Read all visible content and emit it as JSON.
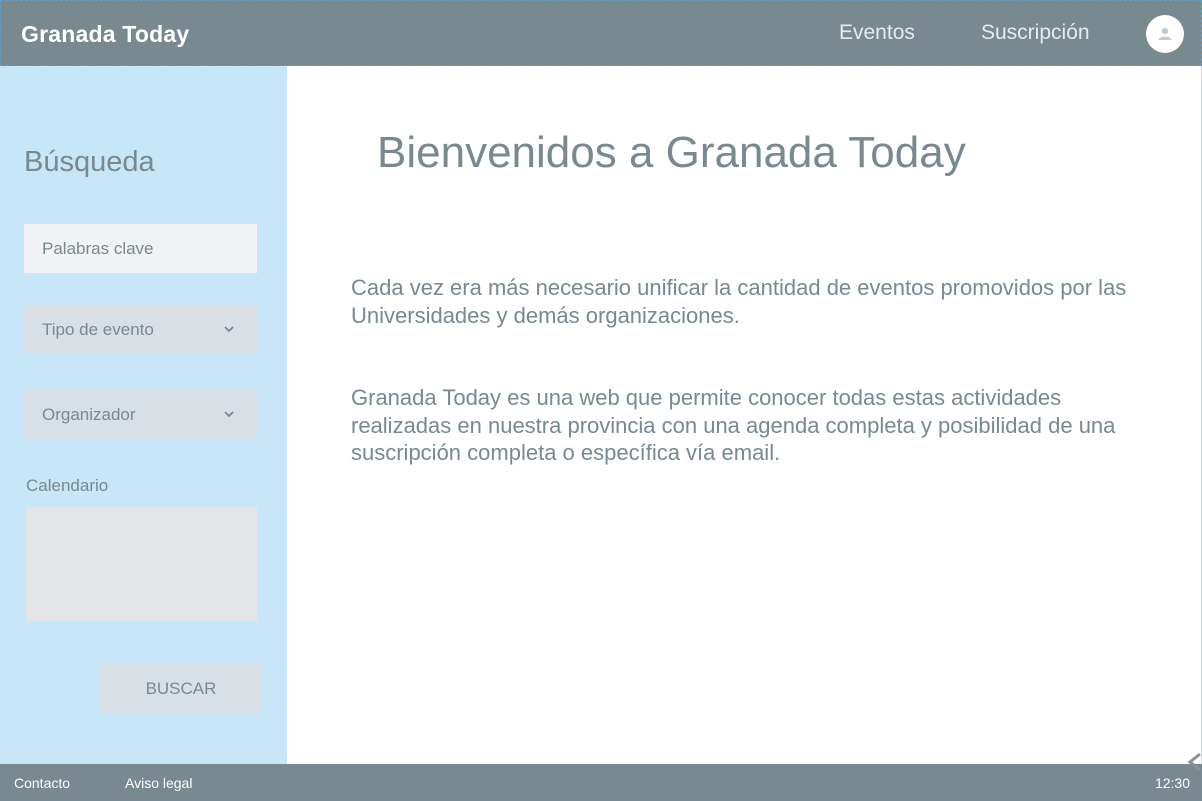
{
  "header": {
    "brand": "Granada Today",
    "nav": {
      "eventos": "Eventos",
      "suscripcion": "Suscripción"
    },
    "avatar_icon": "user-icon"
  },
  "sidebar": {
    "title": "Búsqueda",
    "keywords_placeholder": "Palabras clave",
    "event_type_label": "Tipo de evento",
    "organizer_label": "Organizador",
    "calendar_label": "Calendario",
    "search_button": "BUSCAR"
  },
  "main": {
    "title": "Bienvenidos a Granada Today",
    "paragraph1": "Cada vez era más necesario unificar la cantidad de eventos promovidos por las Universidades y demás organizaciones.",
    "paragraph2": "Granada Today es una web que permite conocer todas estas actividades realizadas en nuestra provincia con una agenda completa y posibilidad de una suscripción completa o específica vía email."
  },
  "footer": {
    "contacto": "Contacto",
    "aviso_legal": "Aviso legal",
    "clock": "12:30"
  },
  "colors": {
    "header_bg": "#78898f",
    "sidebar_bg": "#c7e6f8",
    "text_gray": "#78898f",
    "control_bg": "#d8e0e5"
  }
}
